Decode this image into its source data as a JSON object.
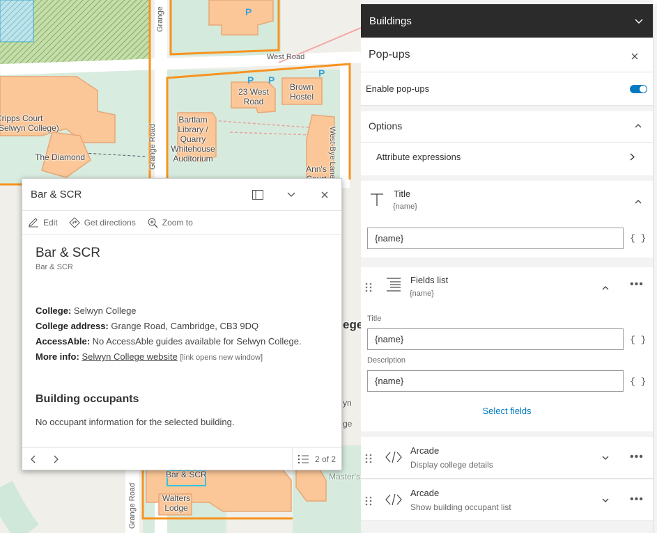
{
  "map": {
    "roads": [
      "Grange",
      "West Road",
      "Grange Road",
      "West-Bye Lane",
      "Grange Road"
    ],
    "buildings": [
      "23 West Road",
      "Brown Hostel",
      "Cripps Court (Selwyn College)",
      "The Diamond",
      "Bartlam Library / Quarry Whitehouse Auditorium",
      "Ann's Court",
      "Walters Lodge",
      "Bar & SCR",
      "Master's"
    ],
    "college_partial": "ege",
    "side_partial_1": "yn",
    "side_partial_2": "ge"
  },
  "popup": {
    "title": "Bar & SCR",
    "actions": {
      "edit": "Edit",
      "directions": "Get directions",
      "zoom": "Zoom to"
    },
    "heading": "Bar & SCR",
    "subheading": "Bar & SCR",
    "college_label": "College:",
    "college_value": "Selwyn College",
    "address_label": "College address:",
    "address_value": "Grange Road, Cambridge, CB3 9DQ",
    "accessable_label": "AccessAble:",
    "accessable_value": "No AccessAble guides available for Selwyn College.",
    "moreinfo_label": "More info:",
    "moreinfo_link": "Selwyn College website",
    "moreinfo_note": "[link opens new window]",
    "occupants_heading": "Building occupants",
    "occupants_text": "No occupant information for the selected building.",
    "page_count": "2 of 2"
  },
  "panel": {
    "header_title": "Buildings",
    "popups_title": "Pop-ups",
    "enable_label": "Enable pop-ups",
    "enable_on": true,
    "options_label": "Options",
    "attr_expr_label": "Attribute expressions",
    "title_block": {
      "label": "Title",
      "sub": "{name}",
      "value": "{name}",
      "brace": "{ }"
    },
    "fields_block": {
      "label": "Fields list",
      "sub": "{name}",
      "title_label": "Title",
      "title_value": "{name}",
      "desc_label": "Description",
      "desc_value": "{name}",
      "brace": "{ }",
      "select_fields": "Select fields"
    },
    "arcade_1": {
      "label": "Arcade",
      "sub": "Display college details"
    },
    "arcade_2": {
      "label": "Arcade",
      "sub": "Show building occupant list"
    }
  },
  "colors": {
    "accent": "#0079c1",
    "header_bg": "#2b2b2b",
    "boundary": "#f7931e",
    "building": "#fbc798",
    "green": "#cfe8d9"
  }
}
